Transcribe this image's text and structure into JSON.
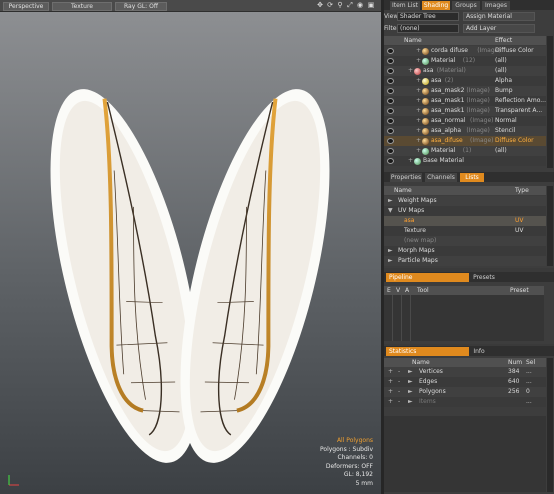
{
  "viewport": {
    "toolbar": {
      "perspective": "Perspective",
      "texture": "Texture",
      "raygl": "Ray GL: Off"
    },
    "stats": {
      "selection": "All Polygons",
      "polygons": "Polygons : Subdiv",
      "channels": "Channels: 0",
      "deformers": "Deformers: OFF",
      "gl": "GL: 8,192",
      "size": "5 mm"
    }
  },
  "top_tabs": [
    "Item List",
    "Shading",
    "Groups",
    "Images"
  ],
  "shader": {
    "view_label": "View",
    "view_value": "Shader Tree",
    "assign_button": "Assign Material",
    "filter_label": "Filter",
    "filter_value": "(none)",
    "add_layer": "Add Layer",
    "col_name": "Name",
    "col_effect": "Effect",
    "rows": [
      {
        "name": "corda difuse",
        "type": "(Image)",
        "effect": "Diffuse Color",
        "kind": "image",
        "indent": 2
      },
      {
        "name": "Material",
        "type": "(12)",
        "effect": "(all)",
        "kind": "material",
        "indent": 2
      },
      {
        "name": "asa",
        "type": "(Material)",
        "effect": "(all)",
        "kind": "group",
        "indent": 1
      },
      {
        "name": "asa",
        "type": "(2)",
        "effect": "Alpha",
        "kind": "alpha",
        "indent": 2
      },
      {
        "name": "asa_mask2",
        "type": "(Image)",
        "effect": "Bump",
        "kind": "image",
        "indent": 2
      },
      {
        "name": "asa_mask1",
        "type": "(Image)",
        "effect": "Reflection Amo...",
        "kind": "image",
        "indent": 2
      },
      {
        "name": "asa_mask1",
        "type": "(Image)",
        "effect": "Transparent A...",
        "kind": "image",
        "indent": 2
      },
      {
        "name": "asa_normal",
        "type": "(Image)",
        "effect": "Normal",
        "kind": "image",
        "indent": 2
      },
      {
        "name": "asa_alpha",
        "type": "(Image)",
        "effect": "Stencil",
        "kind": "image",
        "indent": 2
      },
      {
        "name": "asa_difuse",
        "type": "(Image)",
        "effect": "Diffuse Color",
        "kind": "image",
        "indent": 2,
        "selected": true
      },
      {
        "name": "Material",
        "type": "(1)",
        "effect": "(all)",
        "kind": "material",
        "indent": 2
      },
      {
        "name": "Base Material",
        "type": "",
        "effect": "",
        "kind": "material",
        "indent": 1
      }
    ]
  },
  "mid_tabs": [
    "Properties",
    "Channels",
    "Lists"
  ],
  "lists": {
    "col_name": "Name",
    "col_type": "Type",
    "rows": [
      {
        "name": "Weight Maps",
        "type": "",
        "arrow": "►",
        "indent": 0
      },
      {
        "name": "UV Maps",
        "type": "",
        "arrow": "▼",
        "indent": 0
      },
      {
        "name": "asa",
        "type": "UV",
        "arrow": "",
        "indent": 1,
        "selected": true
      },
      {
        "name": "Texture",
        "type": "UV",
        "arrow": "",
        "indent": 1
      },
      {
        "name": "(new map)",
        "type": "",
        "arrow": "",
        "indent": 1,
        "dim": true
      },
      {
        "name": "Morph Maps",
        "type": "",
        "arrow": "►",
        "indent": 0
      },
      {
        "name": "Particle Maps",
        "type": "",
        "arrow": "►",
        "indent": 0
      }
    ]
  },
  "pipeline": {
    "tabs": [
      "Pipeline",
      "Presets"
    ],
    "cols": [
      "E",
      "V",
      "A",
      "Tool",
      "Preset"
    ]
  },
  "statistics": {
    "tabs": [
      "Statistics",
      "Info"
    ],
    "col_name": "Name",
    "col_num": "Num",
    "col_sel": "Sel",
    "rows": [
      {
        "name": "Vertices",
        "num": "384",
        "sel": "..."
      },
      {
        "name": "Edges",
        "num": "640",
        "sel": "..."
      },
      {
        "name": "Polygons",
        "num": "256",
        "sel": "0"
      },
      {
        "name": "Items",
        "num": "",
        "sel": "...",
        "dim": true
      }
    ]
  }
}
